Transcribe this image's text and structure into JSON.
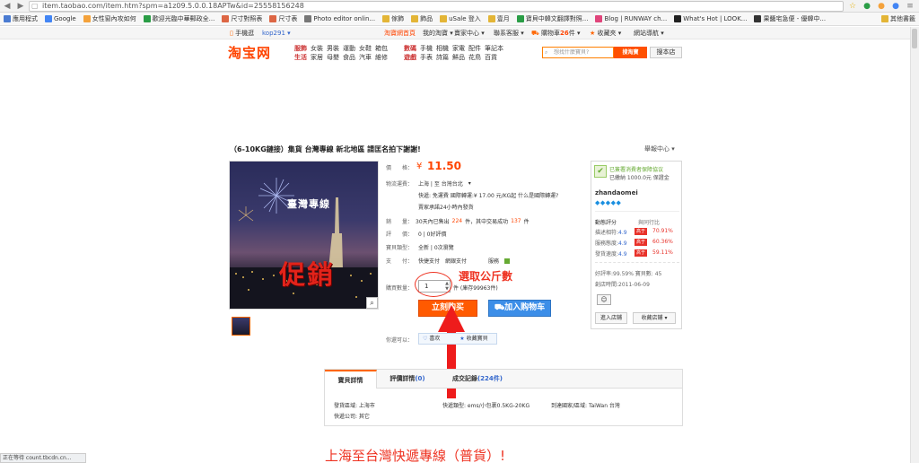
{
  "browser": {
    "url": "item.taobao.com/item.htm?spm=a1z09.5.0.0.18APTw&id=25558156248",
    "status_text": "正在等待 count.tbcdn.cn..."
  },
  "bookmarks": [
    {
      "label": "應用程式",
      "color": "#4a7bd1"
    },
    {
      "label": "Google",
      "color": "#4285f4"
    },
    {
      "label": "女性窗內攻如何",
      "color": "#f4a23b"
    },
    {
      "label": "歡迎光臨中華郵政全...",
      "color": "#2a9d46"
    },
    {
      "label": "尺寸對照表",
      "color": "#d64"
    },
    {
      "label": "尺寸表",
      "color": "#d64"
    },
    {
      "label": "Photo editor onlin...",
      "color": "#777"
    },
    {
      "label": "傢飾",
      "color": "#e3b536"
    },
    {
      "label": "飾品",
      "color": "#e3b536"
    },
    {
      "label": "uSale 登入",
      "color": "#e3b536"
    },
    {
      "label": "壹月",
      "color": "#e3b536"
    },
    {
      "label": "寶貝中韓文翻譯對照...",
      "color": "#2a9d46"
    },
    {
      "label": "Blog | RUNWAY ch...",
      "color": "#e0457b"
    },
    {
      "label": "What's Hot | LOOK...",
      "color": "#222"
    },
    {
      "label": "果醬宅急便 - 優韓中...",
      "color": "#333"
    },
    {
      "label": "其他書籤",
      "color": "#e3b536"
    }
  ],
  "topbar": {
    "mobile": "手機逛",
    "user": "kop291",
    "home": "淘寶網首頁",
    "my_taobao": "我的淘寶",
    "seller_center": "賣家中心",
    "contact": "聯系客服",
    "cart": "購物車",
    "cart_count": "26",
    "cart_unit": "件",
    "favorites": "收藏夾",
    "site_nav": "網站導航"
  },
  "header": {
    "logo": "淘宝网",
    "groups": [
      {
        "h1": "服飾",
        "h2": "生活",
        "r1": [
          "女裝",
          "男裝",
          "運動",
          "女鞋",
          "箱包"
        ],
        "r2": [
          "家居",
          "母嬰",
          "食品",
          "汽車",
          "維修"
        ]
      },
      {
        "h1": "數碼",
        "h2": "遊戲",
        "r1": [
          "手機",
          "相機",
          "家電",
          "配件",
          "筆記本"
        ],
        "r2": [
          "手表",
          "詩篇",
          "鮮品",
          "花鳥",
          "百貨"
        ]
      }
    ],
    "search_placeholder": "想找什麼寶貝?",
    "search_button": "搜淘寶",
    "search_all_button": "搜本店"
  },
  "product": {
    "title": "（6-10KG鏈接）集貨 台灣專線 新北地區 請匡名拍下謝謝!",
    "report": "舉報中心",
    "image_text_top": "臺灣專線",
    "image_text_main": "促銷",
    "price_label": "價　　格：",
    "price_currency": "¥",
    "price": "11.50",
    "shipping_label": "物流運費：",
    "shipping_route": "上海 | 至 台灣台北",
    "shipping_detail": "快遞: 免運費 國際轉運:¥ 17.00 元/KG起 什么是國際轉運?",
    "shipping_note": "賣家承諾24小時內發貨",
    "sales_label": "銷　　量：",
    "sales_text_a": "30天內已售出",
    "sales_count": "224",
    "sales_text_b": "件，其中交易成功",
    "sales_success": "137",
    "sales_text_c": "件",
    "rating_label": "評　　價：",
    "rating_text": "0 | 0好評價",
    "type_label": "寶貝類型：",
    "type_text": "全新 | 0次瀏覽",
    "pay_label": "支　　付：",
    "pay_text": "快捷支付　網銀支付",
    "pay_more": "服務",
    "qty_label": "購買數量：",
    "qty_value": "1",
    "qty_unit": "件 (庫存99963件)",
    "annotation": "選取公斤數",
    "buy_now": "立刻购买",
    "add_to_cart": "加入购物车",
    "share_label": "你還可以：",
    "like": "喜欢",
    "collect": "收藏寶貝"
  },
  "seller": {
    "protection": "已簽署消費者保障協议",
    "deposit": "已繳納 1000.0元 保證金",
    "name": "zhandaomei",
    "dsr_title": "動態評分",
    "compare_title": "與同行比",
    "scores": [
      {
        "label": "描述相符:",
        "score": "4.9",
        "tag": "高于",
        "pct": "70.91%"
      },
      {
        "label": "服務態度:",
        "score": "4.9",
        "tag": "高于",
        "pct": "60.36%"
      },
      {
        "label": "發貨速度:",
        "score": "4.9",
        "tag": "高于",
        "pct": "59.11%"
      }
    ],
    "goodrate": "好評率:99.59% 寶貝數: 45",
    "since": "創店時間:2011-06-09",
    "enter_shop": "進入店鋪",
    "collect_shop": "收藏店鋪"
  },
  "tabs": {
    "details": "寶貝詳情",
    "reviews_label": "評價詳情",
    "reviews_count": "(0)",
    "records_label": "成交記錄",
    "records_count": "(224件)"
  },
  "attrs": {
    "a1": "發貨區域: 上海市",
    "a2": "快遞類型: ems/小包裹0.5KG-20KG",
    "a3": "到達國家/區域: TaiWan 台灣",
    "a4": "快遞公司: 其它"
  },
  "banner": {
    "big_title": "上海至台灣快遞專線（普貨）!"
  },
  "colors": {
    "brand": "#ff4400",
    "buy": "#ff5a00",
    "cart": "#3c8ee8",
    "annotation": "#e32222"
  }
}
